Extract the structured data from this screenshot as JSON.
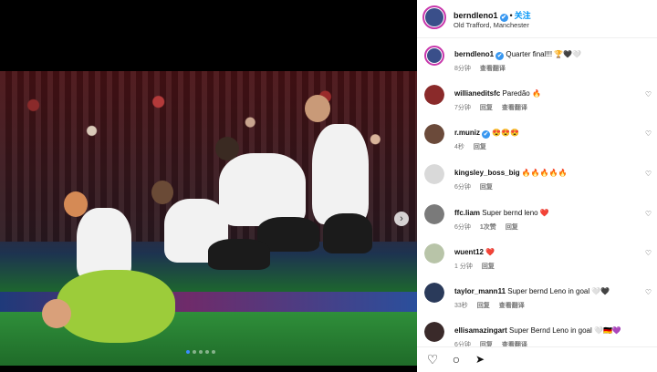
{
  "post": {
    "username": "berndleno1",
    "follow_label": "关注",
    "separator": "•",
    "location": "Old Trafford, Manchester",
    "verified_icon": "✔"
  },
  "media": {
    "nav_arrow": "›",
    "slide_count": 5,
    "active_slide": 1
  },
  "comments": [
    {
      "user": "berndleno1",
      "verified": true,
      "text": "Quarter final!!! 🏆🖤🤍",
      "time": "8分钟",
      "likes": "",
      "reply": "",
      "translate": "查看翻译",
      "avatar_color": "#3a4f8a",
      "heart": ""
    },
    {
      "user": "willianeditsfc",
      "verified": false,
      "text": "Paredão 🔥",
      "time": "7分钟",
      "likes": "",
      "reply": "回复",
      "translate": "查看翻译",
      "avatar_color": "#8a2a2a",
      "heart": "♡"
    },
    {
      "user": "r.muniz",
      "verified": true,
      "text": "😍😍😍",
      "time": "4秒",
      "likes": "",
      "reply": "回复",
      "translate": "",
      "avatar_color": "#6b4a3a",
      "heart": "♡"
    },
    {
      "user": "kingsley_boss_big",
      "verified": false,
      "text": "🔥🔥🔥🔥🔥",
      "time": "6分钟",
      "likes": "",
      "reply": "回复",
      "translate": "",
      "avatar_color": "#d9d9d9",
      "heart": "♡"
    },
    {
      "user": "ffc.liam",
      "verified": false,
      "text": "Super bernd leno ❤️",
      "time": "6分钟",
      "likes": "1次赞",
      "reply": "回复",
      "translate": "",
      "avatar_color": "#7a7a7a",
      "heart": "♡"
    },
    {
      "user": "wuent12",
      "verified": false,
      "text": "❤️",
      "time": "1 分钟",
      "likes": "",
      "reply": "回复",
      "translate": "",
      "avatar_color": "#b8c4a8",
      "heart": "♡"
    },
    {
      "user": "taylor_mann11",
      "verified": false,
      "text": "Super bernd Leno in goal 🤍🖤",
      "time": "33秒",
      "likes": "",
      "reply": "回复",
      "translate": "查看翻译",
      "avatar_color": "#2a3a5a",
      "heart": "♡"
    },
    {
      "user": "ellisamazingart",
      "verified": false,
      "text": "Super Bernd Leno in goal 🤍🇩🇪💜",
      "time": "6分钟",
      "likes": "",
      "reply": "回复",
      "translate": "查看翻译",
      "avatar_color": "#3a2a2a",
      "heart": ""
    }
  ],
  "actions": {
    "like_icon": "♡",
    "comment_icon": "○",
    "share_icon": "➤"
  },
  "colors": {
    "accent": "#0095f6",
    "verified": "#3897f0",
    "story_ring": "#c837ab"
  }
}
